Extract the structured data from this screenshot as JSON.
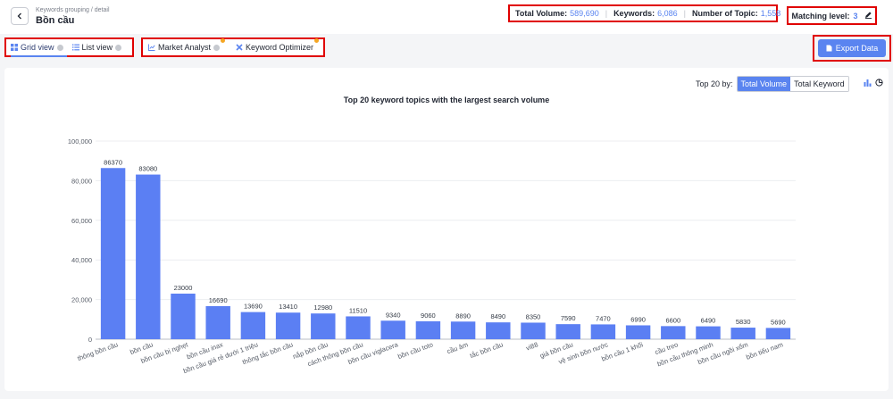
{
  "header": {
    "breadcrumb": "Keywords grouping / detail",
    "title": "Bồn cầu"
  },
  "stats": {
    "total_volume_label": "Total Volume:",
    "total_volume_value": "589,690",
    "keywords_label": "Keywords:",
    "keywords_value": "6,086",
    "topics_label": "Number of Topic:",
    "topics_value": "1,558",
    "matching_label": "Matching level:",
    "matching_value": "3"
  },
  "toolbar": {
    "grid_view": "Grid view",
    "list_view": "List view",
    "market_analyst": "Market Analyst",
    "keyword_optimizer": "Keyword Optimizer",
    "export": "Export Data"
  },
  "chart_controls": {
    "top_by_label": "Top 20 by:",
    "total_volume_btn": "Total Volume",
    "total_keyword_btn": "Total Keyword"
  },
  "colors": {
    "accent": "#5a84f0",
    "highlight_border": "#e00000",
    "badge": "#f5a623"
  },
  "chart_data": {
    "type": "bar",
    "title": "Top 20 keyword topics with the largest search volume",
    "xlabel": "",
    "ylabel": "",
    "ylim": [
      0,
      100000
    ],
    "yticks": [
      0,
      20000,
      40000,
      60000,
      80000,
      100000
    ],
    "ytick_labels": [
      "0",
      "20,000",
      "40,000",
      "60,000",
      "80,000",
      "100,000"
    ],
    "grid": true,
    "categories": [
      "thông bồn cầu",
      "bồn cầu",
      "bồn cầu bị nghẹt",
      "bồn cầu inax",
      "bồn cầu giá rẻ dưới 1 triệu",
      "thông tắc bồn cầu",
      "nắp bồn cầu",
      "cách thông bồn cầu",
      "bồn cầu viglacera",
      "bồn cầu toto",
      "cầu âm",
      "tắc bồn cầu",
      "vi88",
      "giá bồn cầu",
      "vệ sinh bồn nước",
      "bồn cầu 1 khối",
      "cầu treo",
      "bồn cầu thông minh",
      "bồn cầu ngồi xổm",
      "bồn tiểu nam"
    ],
    "values": [
      86370,
      83080,
      23000,
      16690,
      13690,
      13410,
      12980,
      11510,
      9340,
      9060,
      8890,
      8490,
      8350,
      7590,
      7470,
      6990,
      6600,
      6490,
      5830,
      5690
    ]
  }
}
